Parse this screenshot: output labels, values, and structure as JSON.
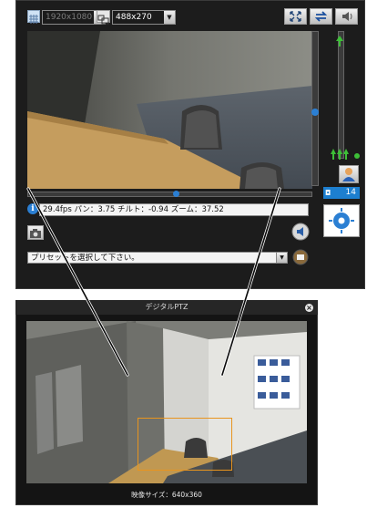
{
  "toolbar": {
    "resolution_value": "1920x1080",
    "display_size_value": "488x270"
  },
  "status": {
    "text": "29.4fps パン：3.75 チルト：-0.94 ズーム：37.52"
  },
  "preset": {
    "placeholder": "プリセットを選択して下さい。"
  },
  "side": {
    "value_display": "14"
  },
  "digital_ptz": {
    "title": "デジタルPTZ",
    "image_size_label": "映像サイズ：640x360"
  },
  "colors": {
    "accent": "#2b7fd3",
    "selection_box": "#e8941e"
  }
}
